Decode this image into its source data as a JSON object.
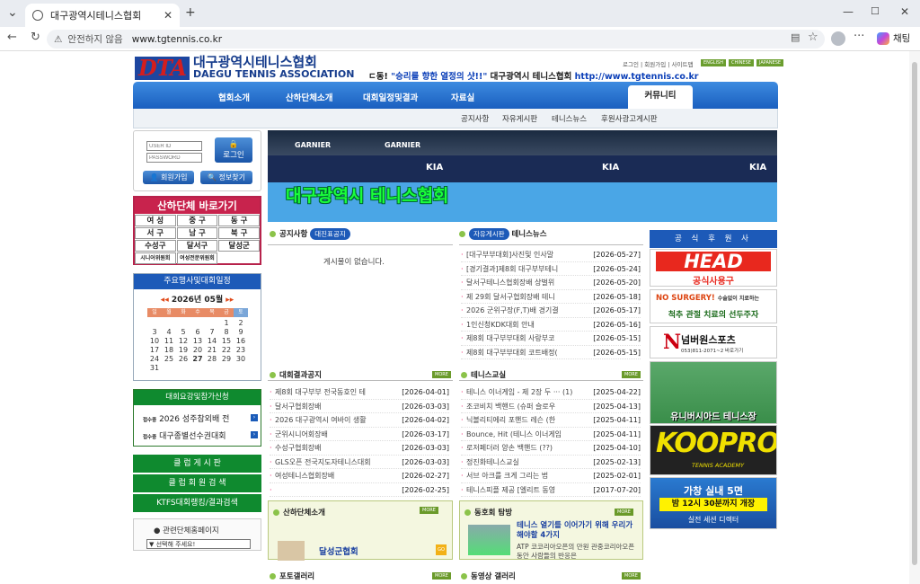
{
  "browser": {
    "tab_title": "대구광역시테니스협회",
    "security_label": "안전하지 않음",
    "url": "www.tgtennis.co.kr",
    "copilot_label": "채팅"
  },
  "header": {
    "logo_abbr": "DTA",
    "logo_korean": "대구광역시테니스협회",
    "logo_english": "DAEGU TENNIS ASSOCIATION",
    "slogan_prefix": "ㄷ동!",
    "slogan_quote": "\"승리를 향한 열정의 샷!!\"",
    "slogan_name": "대구광역시 테니스협회",
    "slogan_url": "http://www.tgtennis.co.kr",
    "top_links": [
      "로그인",
      "회원가입",
      "사이트맵"
    ],
    "languages": [
      "ENGLISH",
      "CHINESE",
      "JAPANESE"
    ]
  },
  "nav": {
    "items": [
      "협회소개",
      "산하단체소개",
      "대회일정및결과",
      "자료실",
      "커뮤니티"
    ],
    "active": "커뮤니티",
    "sub_items": [
      "공지사항",
      "자유게시판",
      "테니스뉴스",
      "후원사광고게시판"
    ]
  },
  "login": {
    "id_placeholder": "USER ID",
    "pw_placeholder": "PASSWORD",
    "login_button": "로그인",
    "join_button": "회원가입",
    "find_button": "정보찾기"
  },
  "quick": {
    "title": "산하단체 바로가기",
    "items": [
      "여 성",
      "중 구",
      "동 구",
      "서 구",
      "남 구",
      "북 구",
      "수성구",
      "달서구",
      "달성군",
      "시니어위원회",
      "여성전문위원회"
    ]
  },
  "calendar": {
    "title": "주요행사및대회일정",
    "month": "2026년 05월",
    "weekdays": [
      "일",
      "월",
      "화",
      "수",
      "목",
      "금",
      "토"
    ],
    "days": [
      "",
      "",
      "",
      "",
      "",
      "1",
      "2",
      "3",
      "4",
      "5",
      "6",
      "7",
      "8",
      "9",
      "10",
      "11",
      "12",
      "13",
      "14",
      "15",
      "16",
      "17",
      "18",
      "19",
      "20",
      "21",
      "22",
      "23",
      "24",
      "25",
      "26",
      "27",
      "28",
      "29",
      "30",
      "31",
      "",
      "",
      "",
      "",
      "",
      ""
    ]
  },
  "apply": {
    "title": "대회요강및참가신청",
    "rows": [
      {
        "tag": "접수중",
        "label": "2026 성주참외배 전"
      },
      {
        "tag": "접수중",
        "label": "대구종별선수권대회"
      }
    ]
  },
  "side_buttons": [
    "클 럽 게 시 판",
    "클 럽 회 원 검 색",
    "KTFS대회랭킹/결과검색"
  ],
  "related": {
    "title": "관련단체홈페이지",
    "select": "▼ 선택해 주세요!"
  },
  "banner": {
    "title": "대구광역시  테니스협회",
    "ads": [
      "KIA",
      "KIA",
      "KIA",
      "GARNIER",
      "GARNIER"
    ]
  },
  "notice": {
    "title": "공지사항",
    "tag": "대진표공지",
    "empty": "게시물이 없습니다."
  },
  "free_board": {
    "tag": "자유게시판",
    "title": "테니스뉴스",
    "rows": [
      {
        "t": "[대구부부대회]사진및 인사말",
        "d": "[2026-05-27]"
      },
      {
        "t": "[경기결과]제8회 대구부부테니",
        "d": "[2026-05-24]"
      },
      {
        "t": "달서구테니스협회장배 상벌위",
        "d": "[2026-05-20]"
      },
      {
        "t": "제 29회 달서구협회장배 테니",
        "d": "[2026-05-18]"
      },
      {
        "t": "2026 군위구장(F,T)배 경기결",
        "d": "[2026-05-17]"
      },
      {
        "t": "1인신청KDK대회 안내",
        "d": "[2026-05-16]"
      },
      {
        "t": "제8회 대구부부대회 사랑부코",
        "d": "[2026-05-15]"
      },
      {
        "t": "제8회 대구부부대회 코트배정(",
        "d": "[2026-05-15]"
      }
    ]
  },
  "results": {
    "title": "대회결과공지",
    "more": "MORE",
    "rows": [
      {
        "t": "제8회 대구부부 전국동호인 테",
        "d": "[2026-04-01]"
      },
      {
        "t": "달서구협회장배",
        "d": "[2026-03-03]"
      },
      {
        "t": "2026 대구광역시 여바이 생활",
        "d": "[2026-04-02]"
      },
      {
        "t": "군위시니어회장배",
        "d": "[2026-03-17]"
      },
      {
        "t": "수성구협회장배",
        "d": "[2026-03-03]"
      },
      {
        "t": "GLS오픈 전국지도자테니스대회",
        "d": "[2026-03-03]"
      },
      {
        "t": "여성테니스협회장배",
        "d": "[2026-02-27]"
      },
      {
        "t": "",
        "d": "[2026-02-25]"
      }
    ]
  },
  "classroom": {
    "title": "테니스교실",
    "more": "MORE",
    "rows": [
      {
        "t": "테니스 이너게임 - 제 2장 두 ··· (1)",
        "d": "[2025-04-22]"
      },
      {
        "t": "조코비치 백핸드 (슈퍼 슬로우",
        "d": "[2025-04-13]"
      },
      {
        "t": "닉볼리티에리 포핸드 레슨 (한",
        "d": "[2025-04-11]"
      },
      {
        "t": "Bounce, Hit (테니스 이너게임",
        "d": "[2025-04-11]"
      },
      {
        "t": "로저페더러 양손 백핸드 (??)",
        "d": "[2025-04-10]"
      },
      {
        "t": "정진화테니스교실",
        "d": "[2025-02-13]"
      },
      {
        "t": "서브 아크를 크게 그리는 법",
        "d": "[2025-02-01]"
      },
      {
        "t": "테니스피플 제공 [엘리트 동영",
        "d": "[2017-07-20]"
      }
    ]
  },
  "club": {
    "title": "산하단체소개",
    "more": "MORE",
    "name": "달성군협회",
    "go": "GO"
  },
  "club_visit": {
    "title": "동호회 탐방",
    "more": "MORE",
    "headline": "테니스 열기를 이어가기 위해 우리가 해야할 4가지",
    "desc": "ATP 코코리아오픈의 만원 관중코리아오픈 동안 사람들의 반응은"
  },
  "photo": {
    "title": "포토갤러리",
    "more": "MORE"
  },
  "video": {
    "title": "동영상 갤러리",
    "more": "MORE"
  },
  "sponsors": {
    "title": "공 식 후 원 사",
    "head_logo": "HEAD",
    "head_sub": "공식사용구",
    "surgery_a": "NO SURGERY!",
    "surgery_small": "수술없이 치료하는",
    "surgery_b": "척추 관절 치료의 선두주자",
    "number_logo": "넘버원스포츠",
    "number_phone": "053)811-2071~2 바로가기",
    "university": "유니버시아드 테니스장",
    "koopro": "KOOPRO",
    "koopro_sub": "TENNIS ACADEMY",
    "indoor_a": "가창 실내 5면",
    "indoor_b": "밤 12시 30분까지 개장",
    "indoor_c": "실전 세션 디렉터"
  },
  "colors": {
    "nav_blue": "#1a5fbf",
    "green": "#0f8a2f",
    "magenta": "#c8234d"
  }
}
